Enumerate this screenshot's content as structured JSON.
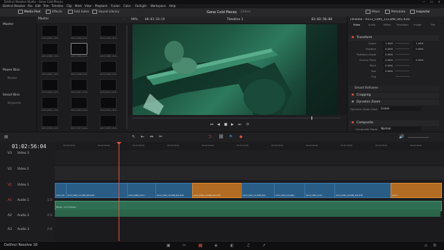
{
  "window": {
    "title": "DaVinci Resolve Studio - Gone Cold Pieces",
    "controls": [
      "—",
      "☐",
      "✕"
    ]
  },
  "menu": [
    "DaVinci Resolve",
    "File",
    "Edit",
    "Trim",
    "Timeline",
    "Clip",
    "Mark",
    "View",
    "Playback",
    "Fusion",
    "Color",
    "Fairlight",
    "Workspace",
    "Help"
  ],
  "toolbar": {
    "media_pool": "Media Pool",
    "effects": "Effects",
    "edit_index": "Edit Index",
    "sound_library": "Sound Library",
    "project_name": "Gone Cold Pieces",
    "project_state": "Edited",
    "mixer": "Mixer",
    "metadata": "Metadata",
    "inspector": "Inspector"
  },
  "media_pool": {
    "bin_title": "Master",
    "bins": {
      "master_label": "Master",
      "power_bins_label": "Power Bins",
      "power_master": "Master",
      "smart_bins_label": "Smart Bins",
      "keywords": "Keywords"
    },
    "clips": [
      "A113_C001_1113...",
      "A113_C002_1113...",
      "A113_C003_1113...",
      "A113_C004_1113...",
      "A113_C005_1113...",
      "A113_C006_1113...",
      "A113_C007_1113...",
      "A113_C008_1113...",
      "A113_C009_1113...",
      "A113_C010_1113...",
      "A113_C011_1113...",
      "A113_C012_1113...",
      "A113_C013_1113...",
      "A113_C014_1113...",
      "A113_C015_1113...",
      "A113_C016_1113...",
      "A113_C017_1113...",
      "A113_C018_1113..."
    ]
  },
  "viewer": {
    "zoom": "99%",
    "source_timecode": "00:03:18:19",
    "timeline_name": "Timeline 1",
    "timecode": "01:02:56:04"
  },
  "inspector": {
    "header": "Timeline - A113_C005_1113AB_001.R3D",
    "tabs": [
      "Video",
      "Audio",
      "Effect",
      "Transition",
      "Image",
      "File"
    ],
    "transform_label": "Transform",
    "props": [
      {
        "label": "Zoom",
        "x": "1.000",
        "y": "1.000"
      },
      {
        "label": "Position",
        "x": "0.000",
        "y": "0.000"
      },
      {
        "label": "Rotation Angle",
        "x": "0.000",
        "y": ""
      },
      {
        "label": "Anchor Point",
        "x": "0.000",
        "y": "0.000"
      },
      {
        "label": "Pitch",
        "x": "0.000",
        "y": ""
      },
      {
        "label": "Yaw",
        "x": "0.000",
        "y": ""
      },
      {
        "label": "Flip",
        "x": "",
        "y": ""
      }
    ],
    "smart_reframe": "Smart Reframe",
    "cropping": "Cropping",
    "dynamic_zoom": "Dynamic Zoom",
    "dynamic_zoom_ease_label": "Dynamic Zoom Ease",
    "dynamic_zoom_ease_value": "Linear",
    "composite": "Composite",
    "composite_mode": "Composite Mode",
    "composite_mode_value": "Normal"
  },
  "timeline": {
    "timecode": "01:02:56:04",
    "ruler": [
      "01:02:50:00",
      "01:02:55:00",
      "01:03:00:00",
      "01:03:05:00",
      "01:03:10:00",
      "01:03:15:00",
      "01:03:20:00",
      "01:03:25:00",
      "01:03:30:00",
      "01:03:35:00",
      "01:03:40:00"
    ],
    "tracks": [
      {
        "id": "V3",
        "name": "Video 3"
      },
      {
        "id": "V2",
        "name": "Video 2"
      },
      {
        "id": "V1",
        "name": "Video 1"
      },
      {
        "id": "A1",
        "name": "Audio 1",
        "level": "1.0"
      },
      {
        "id": "A2",
        "name": "Audio 2",
        "level": "2.0"
      },
      {
        "id": "A3",
        "name": "Audio 3",
        "level": "2.0"
      }
    ],
    "video_clips": [
      "A113_C0...",
      "A113_C002_1113AB_001.R3D",
      "A113_C008_1113...",
      "A113_C002_1113AB_001.R3D",
      "A113_C010_1113AB_001.R3D",
      "A113_C011_1113AB_001...",
      "A113_C014_1113AB_...",
      "A113_C015_1113...",
      "A113_C016_1113AB_001.R3D",
      "A113_..."
    ],
    "audio_clip": "Pieces - 11 17 22.wav"
  },
  "status": {
    "app": "DaVinci Resolve 18"
  }
}
